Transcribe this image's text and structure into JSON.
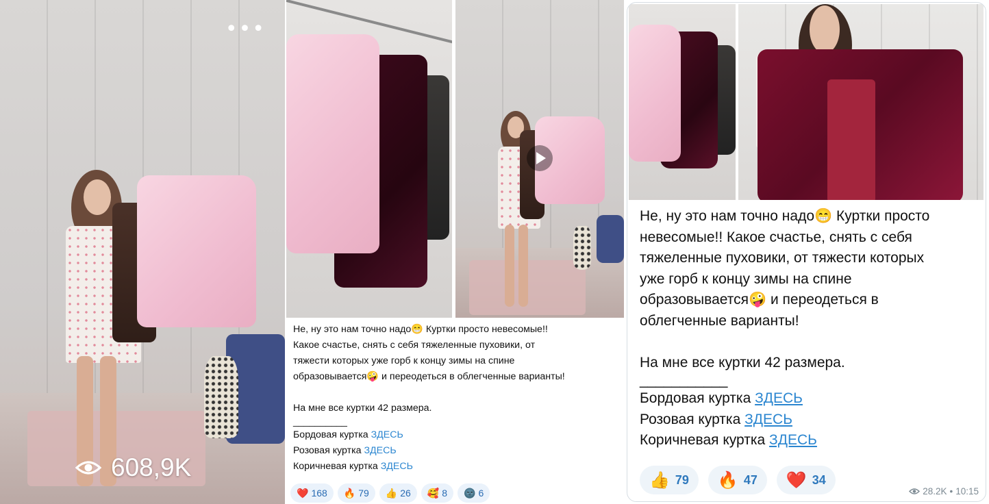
{
  "video_panel": {
    "view_count": "608,9K",
    "more_icon": "more-dots-icon",
    "eye_icon": "eye-icon"
  },
  "post_small": {
    "lines": [
      "Не, ну это нам точно надо😁 Куртки просто невесомые!!",
      "Какое счастье, снять с себя тяжеленные пуховики, от",
      "тяжести которых уже горб к концу зимы на спине",
      "образовывается🤪 и переодеться в облегченные варианты!"
    ],
    "size_note": "На мне все куртки 42 размера.",
    "separator": "__________",
    "links": [
      {
        "label": "Бордовая куртка",
        "link": "ЗДЕСЬ"
      },
      {
        "label": "Розовая куртка",
        "link": "ЗДЕСЬ"
      },
      {
        "label": "Коричневая куртка",
        "link": "ЗДЕСЬ"
      }
    ],
    "reactions": [
      {
        "emoji": "❤️",
        "count": "168"
      },
      {
        "emoji": "🔥",
        "count": "79"
      },
      {
        "emoji": "👍",
        "count": "26"
      },
      {
        "emoji": "🥰",
        "count": "8"
      },
      {
        "emoji": "🌚",
        "count": "6"
      }
    ]
  },
  "post_large": {
    "lines": [
      "Не, ну это нам точно надо😁 Куртки просто",
      "невесомые!! Какое счастье, снять с себя",
      "тяжеленные пуховики, от тяжести которых",
      "уже горб к концу зимы на спине",
      "образовывается🤪 и переодеться в",
      "облегченные варианты!"
    ],
    "size_note": "На мне все куртки 42 размера.",
    "separator": "___________",
    "links": [
      {
        "label": "Бордовая куртка",
        "link": "ЗДЕСЬ"
      },
      {
        "label": "Розовая куртка",
        "link": "ЗДЕСЬ"
      },
      {
        "label": "Коричневая куртка",
        "link": "ЗДЕСЬ"
      }
    ],
    "reactions": [
      {
        "emoji": "👍",
        "count": "79"
      },
      {
        "emoji": "🔥",
        "count": "47"
      },
      {
        "emoji": "❤️",
        "count": "34"
      }
    ],
    "views": "28.2K",
    "time": "10:15"
  },
  "colors": {
    "link": "#2b86d0",
    "reaction_text_small": "#2a6cb3",
    "reaction_text_large": "#2f79bd",
    "meta": "#7d8a93"
  }
}
